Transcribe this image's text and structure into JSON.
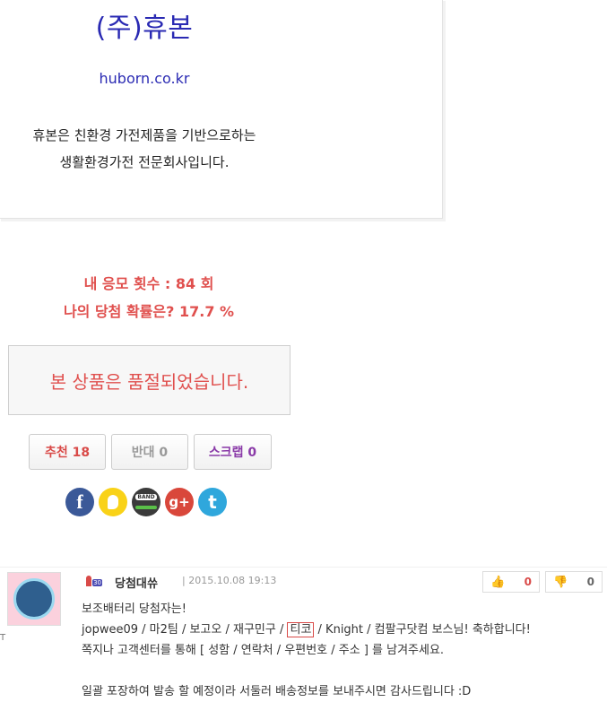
{
  "company": {
    "name": "(주)휴본",
    "url": "huborn.co.kr",
    "desc_line1": "휴본은 친환경 가전제품을 기반으로하는",
    "desc_line2": "생활환경가전 전문회사입니다."
  },
  "stats": {
    "apply_count": "내 응모 횟수 : 84 회",
    "win_rate": "나의 당첨 확률은? 17.7 %"
  },
  "soldout_text": "본 상품은 품절되었습니다.",
  "buttons": {
    "recommend": "추천 18",
    "oppose": "반대 0",
    "scrap": "스크랩 0"
  },
  "share": {
    "icons": [
      "facebook-icon",
      "kakaostory-icon",
      "band-icon",
      "google-plus-icon",
      "twitter-icon"
    ],
    "band_label": "BAND",
    "gplus_label": "g+",
    "fb_label": "f",
    "tw_label": "t"
  },
  "comment": {
    "author": "당첨대쓔",
    "level_badge": "30",
    "date": "| 2015.10.08 19:13",
    "likes": "0",
    "dislikes": "0",
    "line1": "보조배터리 당첨자는!",
    "line2_before": "jopwee09 / 마2팀 / 보고오 / 재구민구 / ",
    "line2_highlight": "티코",
    "line2_after": " / Knight / 컴팔구닷컴 보스님! 축하합니다!",
    "line3": "쪽지나 고객센터를 통해 [ 성함 / 연락처 / 우편번호 / 주소 ] 를 남겨주세요.",
    "line4": "",
    "line5": "일괄 포장하여 발송 할 예정이라 서둘러 배송정보를 보내주시면 감사드립니다 :D"
  },
  "colors": {
    "brand_blue": "#2a2ab3",
    "accent_red": "#e0504e",
    "scrap_purple": "#8a3aa8"
  }
}
